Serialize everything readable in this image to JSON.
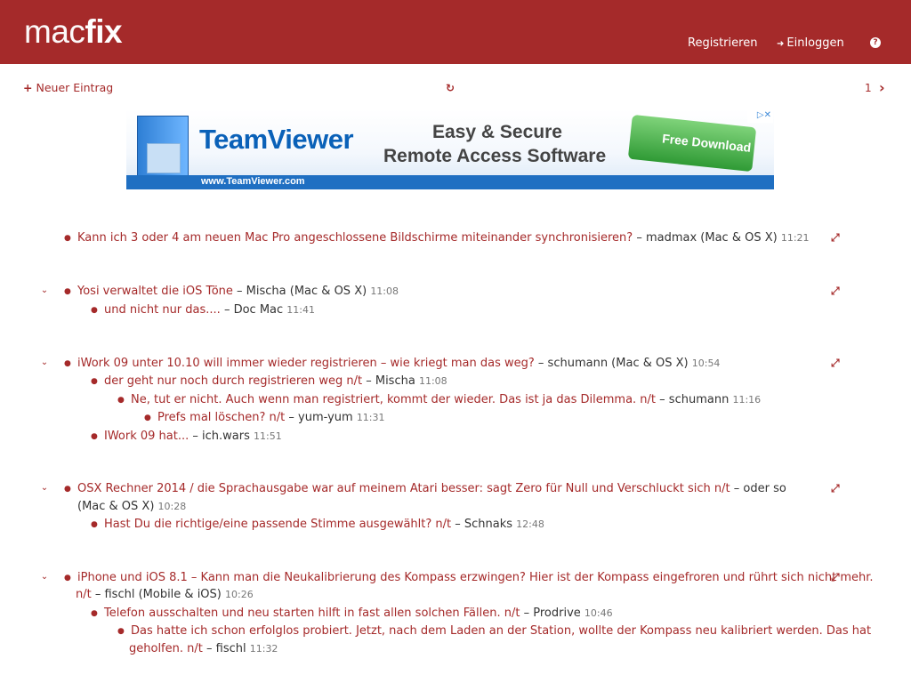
{
  "header": {
    "logo_light": "mac",
    "logo_bold": "fix",
    "register": "Registrieren",
    "login": "Einloggen",
    "help": "?"
  },
  "toolbar": {
    "new_entry": "Neuer Eintrag",
    "page": "1"
  },
  "ad": {
    "brand": "TeamViewer",
    "slogan_line1": "Easy & Secure",
    "slogan_line2": "Remote Access Software",
    "cta": "Free Download",
    "url": "www.TeamViewer.com"
  },
  "threads": [
    {
      "title": "Kann ich 3 oder 4 am neuen Mac Pro angeschlossene Bildschirme miteinander synchronisieren?",
      "author": " – madmax (Mac & OS X)",
      "time": "11:21"
    },
    {
      "title": "Yosi verwaltet die iOS Töne",
      "author": " – Mischa (Mac & OS X)",
      "time": "11:08",
      "replies": [
        {
          "title": "und nicht nur das....",
          "author": " – Doc Mac",
          "time": "11:41"
        }
      ]
    },
    {
      "title": "iWork 09 unter 10.10 will immer wieder registrieren – wie kriegt man das weg?",
      "author": " – schumann (Mac & OS X)",
      "time": "10:54",
      "replies": [
        {
          "title": "der geht nur noch durch registrieren weg n/t",
          "author": " – Mischa",
          "time": "11:08"
        },
        {
          "title": "Ne, tut er nicht. Auch wenn man registriert, kommt der wieder. Das ist ja das Dilemma. n/t",
          "author": " – schumann",
          "time": "11:16"
        },
        {
          "title": "Prefs mal löschen? n/t",
          "author": " – yum-yum",
          "time": "11:31"
        },
        {
          "title": "IWork 09 hat...",
          "author": " – ich.wars",
          "time": "11:51"
        }
      ]
    },
    {
      "title": "OSX Rechner 2014 / die Sprachausgabe war auf meinem Atari besser: sagt Zero für Null und Verschluckt sich n/t",
      "author_line1": " – oder so",
      "author_line2": "(Mac & OS X)",
      "time": "10:28",
      "replies": [
        {
          "title": "Hast Du die richtige/eine passende Stimme ausgewählt? n/t",
          "author": " – Schnaks",
          "time": "12:48"
        }
      ]
    },
    {
      "title_line1": "iPhone und iOS 8.1 – Kann man die Neukalibrierung des Kompass erzwingen? Hier ist der Kompass eingefroren und rührt sich nicht mehr.",
      "title_line2": "n/t",
      "author": " – fischl (Mobile & iOS)",
      "time": "10:26",
      "replies": [
        {
          "title": "Telefon ausschalten und neu starten hilft in fast allen solchen Fällen. n/t",
          "author": " – Prodrive",
          "time": "10:46"
        },
        {
          "title_line1": "Das hatte ich schon erfolglos probiert. Jetzt, nach dem Laden an der Station, wollte der Kompass neu kalibriert werden. Das hat",
          "title_line2": "geholfen. n/t",
          "author": " – fischl",
          "time": "11:32"
        }
      ]
    }
  ]
}
